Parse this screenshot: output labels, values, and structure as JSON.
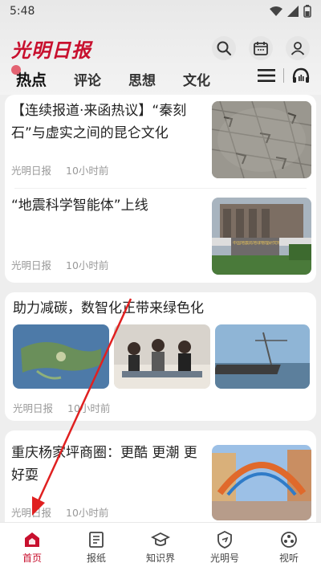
{
  "status_bar": {
    "time": "5:48"
  },
  "header": {
    "logo": "光明日报"
  },
  "nav": {
    "tabs": [
      "热点",
      "评论",
      "思想",
      "文化"
    ]
  },
  "articles": [
    {
      "title": "【连续报道·来函热议】“秦刻石”与虚实之间的昆仑文化",
      "source": "光明日报",
      "time": "10小时前"
    },
    {
      "title": "“地震科学智能体”上线",
      "source": "光明日报",
      "time": "10小时前",
      "image_caption": "中国地震局地球物理研究所"
    },
    {
      "title": "助力减碳，数智化正带来绿色化",
      "source": "光明日报",
      "time": "10小时前"
    },
    {
      "title": "重庆杨家坪商圈：更酷 更潮 更好耍",
      "source": "光明日报",
      "time": "10小时前"
    }
  ],
  "bottom_nav": {
    "items": [
      {
        "label": "首页",
        "icon": "home-icon",
        "active": true
      },
      {
        "label": "报纸",
        "icon": "newspaper-icon"
      },
      {
        "label": "知识界",
        "icon": "graduation-cap-icon"
      },
      {
        "label": "光明号",
        "icon": "shield-icon"
      },
      {
        "label": "视听",
        "icon": "video-icon"
      }
    ]
  },
  "colors": {
    "brand": "#c8102e",
    "annotation_arrow": "#e02020"
  }
}
